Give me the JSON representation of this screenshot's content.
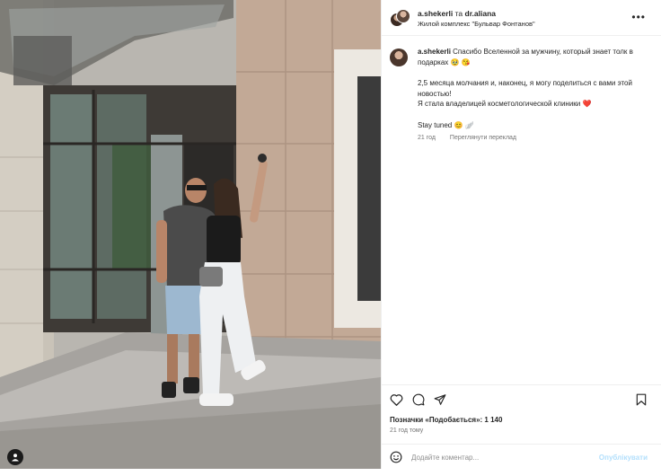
{
  "post": {
    "header": {
      "author1": "a.shekerli",
      "conjunction": "та",
      "author2": "dr.aliana",
      "location": "Жилой комплекс \"Бульвар Фонтанов\"",
      "more_icon": "more-horizontal-icon"
    },
    "caption": {
      "username": "a.shekerli",
      "line1": "Спасибо Вселенной за мужчину, который знает толк в подарках",
      "line1_emoji": "🥹 😘",
      "line2": "2,5 месяца молчания и, наконец, я могу поделиться с вами этой новостью!",
      "line3": "Я стала владелицей косметологической клиники",
      "line3_emoji": "❤️",
      "line4": "Stay tuned",
      "line4_emoji": "😊 🪽",
      "time": "21 год",
      "see_translation": "Переглянути переклад"
    },
    "actions": {
      "like_icon": "heart-icon",
      "comment_icon": "comment-icon",
      "share_icon": "share-icon",
      "save_icon": "bookmark-icon"
    },
    "likes_text": "Позначки «Подобається»: 1 140",
    "ago_text": "21 год тому",
    "comment": {
      "emoji_icon": "emoji-icon",
      "placeholder": "Додайте коментар...",
      "post_label": "Опублікувати"
    },
    "photo_user_icon": "user-icon"
  },
  "colors": {
    "text": "#262626",
    "secondary": "#737373",
    "divider": "#efefef",
    "post_disabled": "#b2dffc"
  }
}
